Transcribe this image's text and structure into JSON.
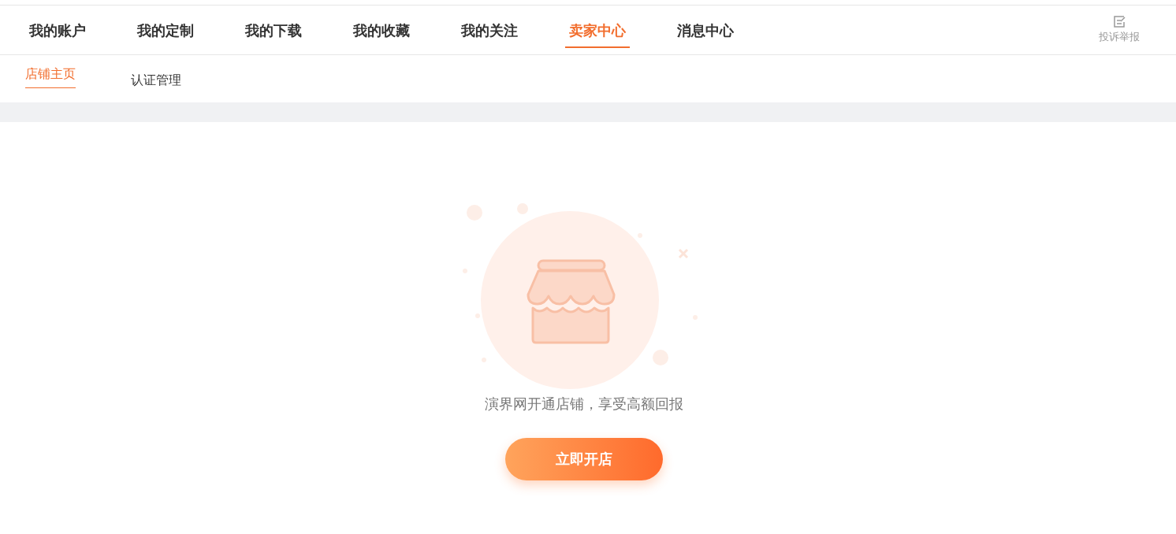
{
  "nav_tabs": [
    {
      "label": "我的账户",
      "selected": false
    },
    {
      "label": "我的定制",
      "selected": false
    },
    {
      "label": "我的下载",
      "selected": false
    },
    {
      "label": "我的收藏",
      "selected": false
    },
    {
      "label": "我的关注",
      "selected": false
    },
    {
      "label": "卖家中心",
      "selected": true
    },
    {
      "label": "消息中心",
      "selected": false
    }
  ],
  "report_link": {
    "label": "投诉举报"
  },
  "sub_tabs": [
    {
      "label": "店铺主页",
      "selected": true
    },
    {
      "label": "认证管理",
      "selected": false
    }
  ],
  "empty_state": {
    "message": "演界网开通店铺，享受高额回报",
    "button": "立即开店"
  }
}
